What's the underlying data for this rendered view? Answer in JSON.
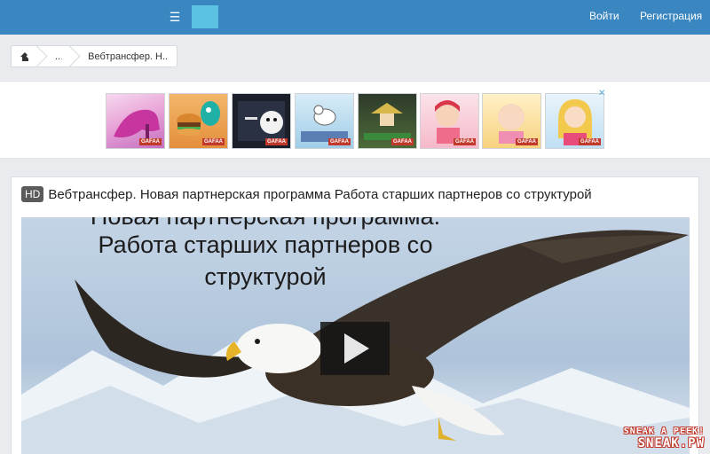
{
  "navbar": {
    "login": "Войти",
    "register": "Регистрация",
    "menu_icon": "hamburger-icon",
    "accent": "#3a86c0",
    "logo_color": "#5bc2e4"
  },
  "breadcrumb": {
    "home_icon": "home-icon",
    "ellipsis": "...",
    "current": "Вебтрансфер. Н.."
  },
  "ads": {
    "tag": "GAFAA",
    "close_icon": "close-icon",
    "count": 8
  },
  "video": {
    "badge": "HD",
    "title": "Вебтрансфер. Новая партнерская программа Работа старших партнеров со структурой",
    "caption_line1": "Новая партнерская программа.",
    "caption_line2": "Работа старших партнеров со",
    "caption_line3": "структурой",
    "play_icon": "play-icon"
  },
  "watermark": {
    "line1": "SNEAK A PEEK!",
    "line2": "SNEAK.PW"
  }
}
